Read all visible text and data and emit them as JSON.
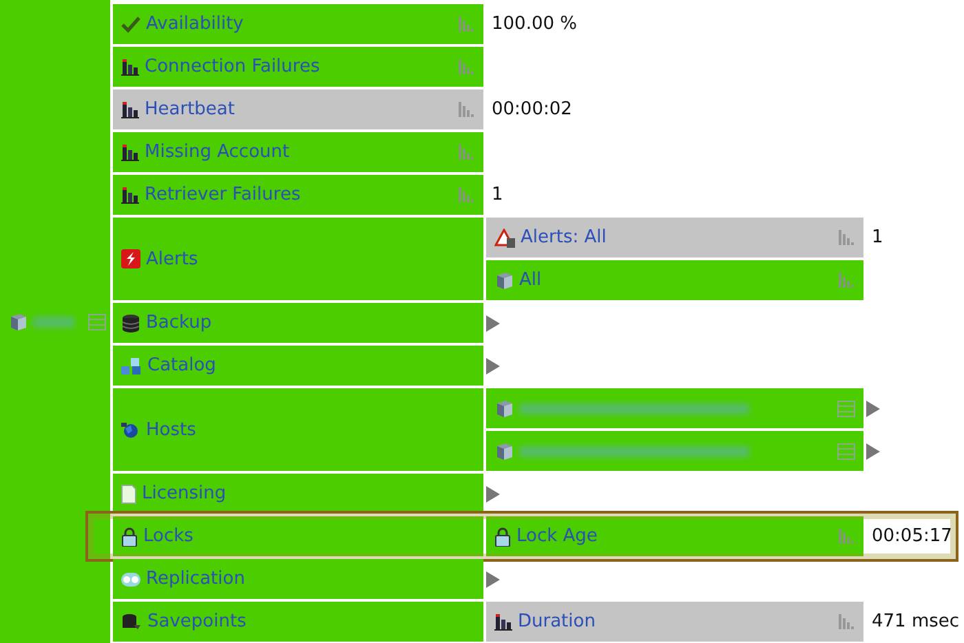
{
  "groups": [
    {
      "kind": "metric",
      "label": "Availability",
      "selected": false,
      "highlighted": false,
      "value": "100.00 %"
    },
    {
      "kind": "metric",
      "label": "Connection Failures",
      "selected": false,
      "highlighted": false
    },
    {
      "kind": "metric",
      "label": "Heartbeat",
      "selected": true,
      "highlighted": false,
      "value": "00:00:02"
    },
    {
      "kind": "metric",
      "label": "Missing Account",
      "selected": false,
      "highlighted": false
    },
    {
      "kind": "metric",
      "label": "Retriever Failures",
      "selected": false,
      "highlighted": false,
      "value": "1"
    },
    {
      "kind": "folder",
      "label": "Alerts",
      "highlighted": false,
      "expanded": true,
      "children": [
        {
          "kind": "metric",
          "label": "Alerts: All",
          "selected": true,
          "value": "1"
        },
        {
          "kind": "metric",
          "label": "All",
          "selected": false
        }
      ]
    },
    {
      "kind": "folder",
      "label": "Backup",
      "highlighted": false,
      "expanded": false
    },
    {
      "kind": "folder",
      "label": "Catalog",
      "highlighted": false,
      "expanded": false
    },
    {
      "kind": "folder",
      "label": "Hosts",
      "highlighted": false,
      "expanded": true,
      "children": [
        {
          "kind": "host",
          "expanded": false
        },
        {
          "kind": "host",
          "expanded": false
        }
      ]
    },
    {
      "kind": "folder",
      "label": "Licensing",
      "highlighted": false,
      "expanded": false
    },
    {
      "kind": "folder",
      "label": "Locks",
      "highlighted": true,
      "expanded": true,
      "children": [
        {
          "kind": "metric",
          "label": "Lock Age",
          "selected": false,
          "value": "00:05:17"
        }
      ]
    },
    {
      "kind": "folder",
      "label": "Replication",
      "highlighted": false,
      "expanded": false
    },
    {
      "kind": "folder",
      "label": "Savepoints",
      "highlighted": false,
      "expanded": true,
      "children": [
        {
          "kind": "metric",
          "label": "Duration",
          "selected": true,
          "value": "471 msec"
        }
      ]
    }
  ]
}
